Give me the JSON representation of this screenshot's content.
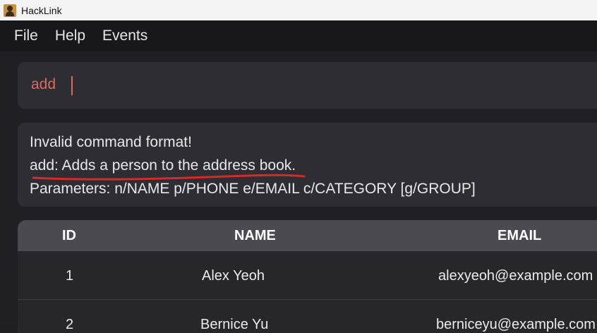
{
  "window": {
    "title": "HackLink"
  },
  "menu": {
    "items": [
      "File",
      "Help",
      "Events"
    ]
  },
  "command": {
    "value": "add"
  },
  "result": {
    "lines": [
      "Invalid command format!",
      "add: Adds a person to the address book.",
      "Parameters: n/NAME p/PHONE e/EMAIL c/CATEGORY [g/GROUP]"
    ]
  },
  "table": {
    "headers": [
      "ID",
      "NAME",
      "EMAIL"
    ],
    "rows": [
      {
        "id": "1",
        "name": "Alex Yeoh",
        "email": "alexyeoh@example.com"
      },
      {
        "id": "2",
        "name": "Bernice Yu",
        "email": "berniceyu@example.com"
      }
    ]
  },
  "colors": {
    "command_text": "#e0685c",
    "annotation_underline": "#d42a2a",
    "background": "#202024"
  }
}
